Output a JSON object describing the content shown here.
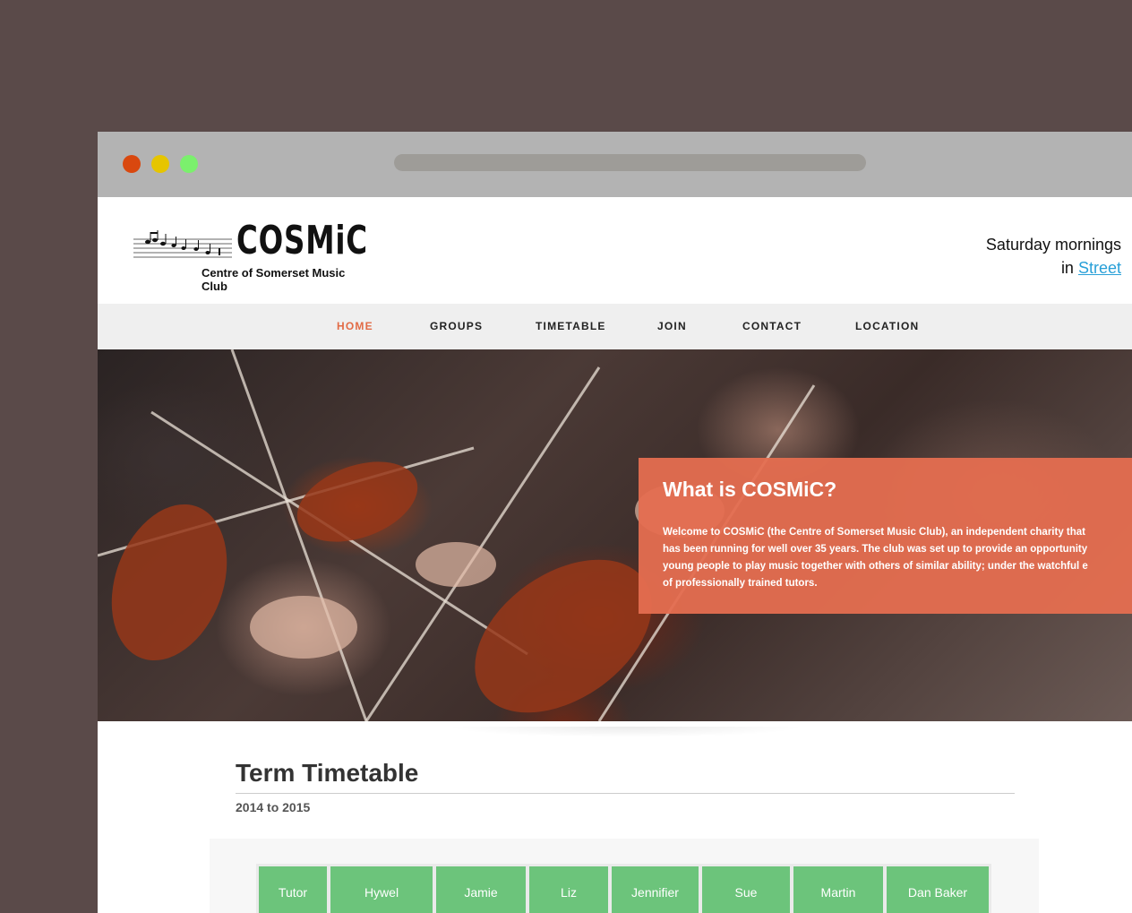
{
  "browser": {
    "controls": [
      "close",
      "minimize",
      "maximize"
    ]
  },
  "header": {
    "logo": {
      "wordmark": "COSMiC",
      "subtitle": "Centre of Somerset Music Club",
      "icon": "music-staff-icon"
    },
    "tagline_line1": "Saturday mornings",
    "tagline_in": "in",
    "tagline_link": "Street"
  },
  "nav": {
    "items": [
      {
        "label": "HOME",
        "active": true
      },
      {
        "label": "GROUPS",
        "active": false
      },
      {
        "label": "TIMETABLE",
        "active": false
      },
      {
        "label": "JOIN",
        "active": false
      },
      {
        "label": "CONTACT",
        "active": false
      },
      {
        "label": "LOCATION",
        "active": false
      }
    ],
    "active_color": "#e26b46"
  },
  "hero": {
    "title": "What is COSMiC?",
    "text": "Welcome to COSMiC (the Centre of Somerset Music Club), an independent charity that\nhas been running for well over 35 years. The club was set up to provide an opportunity\nyoung people to play music together with others of similar ability; under the watchful e\nof professionally trained tutors.",
    "card_color": "#e56e50"
  },
  "timetable": {
    "title": "Term Timetable",
    "subtitle": "2014 to 2015",
    "columns": [
      "Tutor",
      "Hywel",
      "Jamie",
      "Liz",
      "Jennifier",
      "Sue",
      "Martin",
      "Dan Baker"
    ],
    "header_color": "#6cc47b"
  }
}
